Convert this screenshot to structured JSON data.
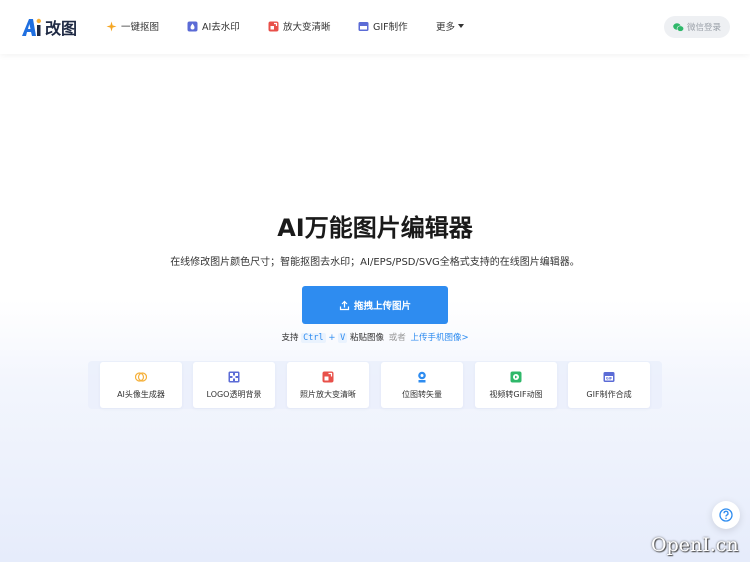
{
  "header": {
    "logo_text": "改图",
    "logo_mark": "Ai",
    "nav": [
      {
        "label": "一键抠图",
        "icon": "sparkle-icon",
        "color": "#f5a623"
      },
      {
        "label": "AI去水印",
        "icon": "water-drop-icon",
        "color": "#5b6bd6"
      },
      {
        "label": "放大变清晰",
        "icon": "enlarge-icon",
        "color": "#e8504a"
      },
      {
        "label": "GIF制作",
        "icon": "gif-icon",
        "color": "#5b6bd6"
      },
      {
        "label": "更多",
        "icon": "chevron-down-icon"
      }
    ],
    "login_label": "微信登录",
    "login_icon": "wechat-icon"
  },
  "hero": {
    "title": "AI万能图片编辑器",
    "subtitle": "在线修改图片颜色尺寸；智能抠图去水印；AI/EPS/PSD/SVG全格式支持的在线图片编辑器。",
    "upload_label": "拖拽上传图片",
    "upload_icon": "upload-icon",
    "paste_prefix": "支持",
    "paste_key1": "Ctrl",
    "paste_plus": "+",
    "paste_key2": "V",
    "paste_suffix": "粘贴图像",
    "or": "或者",
    "mobile_link": "上传手机图像>"
  },
  "tools": [
    {
      "label": "AI头像生成器",
      "icon": "avatar-generator-icon",
      "color": "#f5b03a"
    },
    {
      "label": "LOGO透明背景",
      "icon": "checkerboard-icon",
      "color": "#5b6bd6"
    },
    {
      "label": "照片放大变清晰",
      "icon": "enlarge-icon",
      "color": "#e8504a"
    },
    {
      "label": "位图转矢量",
      "icon": "vector-icon",
      "color": "#2e8cf0"
    },
    {
      "label": "视频转GIF动图",
      "icon": "video-icon",
      "color": "#2fb86a"
    },
    {
      "label": "GIF制作合成",
      "icon": "gif-icon",
      "color": "#5b6bd6"
    }
  ],
  "help_icon": "help-icon",
  "watermark": "OpenI.cn",
  "colors": {
    "accent": "#2e8cf0",
    "brand_text": "#1f2a44"
  }
}
